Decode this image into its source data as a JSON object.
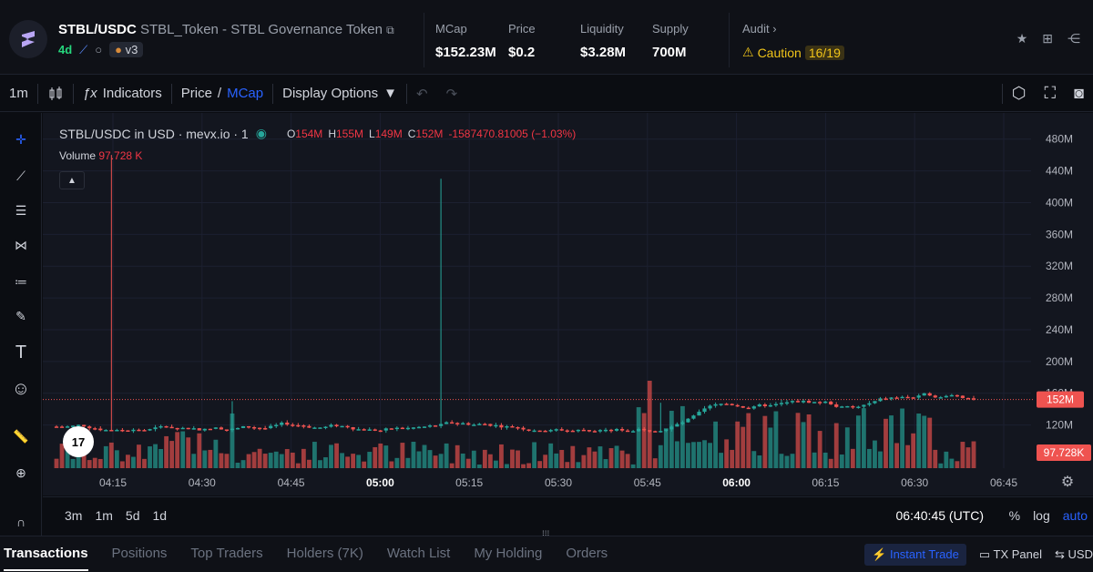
{
  "header": {
    "pair": "STBL/USDC",
    "token_name": "STBL_Token - STBL Governance Token",
    "age": "4d",
    "dex_version": "v3",
    "stats": [
      {
        "label": "MCap",
        "value": "$152.23M"
      },
      {
        "label": "Price",
        "value": "$0.2"
      },
      {
        "label": "Liquidity",
        "value": "$3.28M"
      },
      {
        "label": "Supply",
        "value": "700M"
      }
    ],
    "audit_label": "Audit",
    "caution_label": "Caution",
    "caution_score": "16/19"
  },
  "toolbar": {
    "interval": "1m",
    "indicators": "Indicators",
    "price_label": "Price",
    "slash": "/",
    "mcap_label": "MCap",
    "display_options": "Display Options"
  },
  "chart": {
    "title": "STBL/USDC in USD · mevx.io · 1",
    "ohlc": {
      "o_label": "O",
      "o": "154M",
      "h_label": "H",
      "h": "155M",
      "l_label": "L",
      "l": "149M",
      "c_label": "C",
      "c": "152M",
      "change": "-1587470.81005 (−1.03%)"
    },
    "volume_label": "Volume",
    "volume_value": "97.728 K",
    "price_tag": "152M",
    "volume_tag": "97.728K",
    "tv_logo": "17"
  },
  "chart_data": {
    "type": "candlestick",
    "y_unit": "M",
    "y_ticks": [
      "480M",
      "440M",
      "400M",
      "360M",
      "320M",
      "280M",
      "240M",
      "200M",
      "160M",
      "120M"
    ],
    "x_ticks": [
      "04:15",
      "04:30",
      "04:45",
      "05:00",
      "05:15",
      "05:30",
      "05:45",
      "06:00",
      "06:15",
      "06:30",
      "06:45"
    ],
    "ylim": [
      100,
      490
    ],
    "last_price": 152,
    "volume_last": 97.728
  },
  "bottom": {
    "ranges": [
      "3m",
      "1m",
      "5d",
      "1d"
    ],
    "clock": "06:40:45 (UTC)",
    "pct": "%",
    "log": "log",
    "auto": "auto"
  },
  "tabs": [
    "Transactions",
    "Positions",
    "Top Traders",
    "Holders (7K)",
    "Watch List",
    "My Holding",
    "Orders"
  ],
  "tab_right": {
    "instant": "Instant Trade",
    "tx_panel": "TX Panel",
    "usd": "USD"
  },
  "colors": {
    "up": "#26a69a",
    "down": "#ef5350",
    "accent": "#2962ff",
    "caution": "#f0c419"
  }
}
